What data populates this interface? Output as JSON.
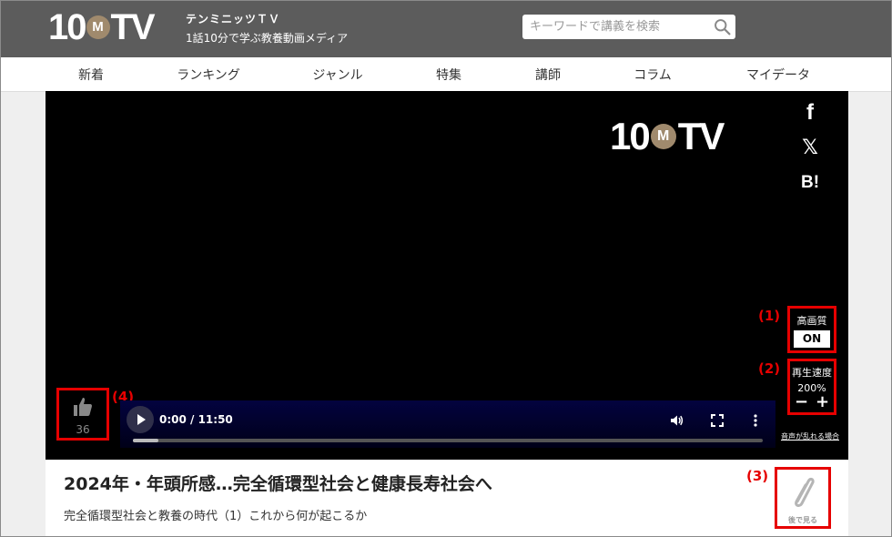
{
  "header": {
    "logo_prefix": "10",
    "logo_ball": "M",
    "logo_suffix": "TV",
    "site_name": "テンミニッツＴＶ",
    "tagline": "1話10分で学ぶ教養動画メディア",
    "search_placeholder": "キーワードで講義を検索",
    "search_icon": "magnifier-icon"
  },
  "nav": {
    "items": [
      {
        "label": "新着"
      },
      {
        "label": "ランキング"
      },
      {
        "label": "ジャンル"
      },
      {
        "label": "特集"
      },
      {
        "label": "講師"
      },
      {
        "label": "コラム"
      },
      {
        "label": "マイデータ"
      }
    ]
  },
  "player": {
    "logo_prefix": "10",
    "logo_ball": "M",
    "logo_suffix": "TV",
    "share": {
      "facebook": "f",
      "x": "𝕏",
      "hatena": "B!"
    },
    "quality": {
      "callout": "(1)",
      "label": "高画質",
      "button": "ON"
    },
    "speed": {
      "callout": "(2)",
      "label": "再生速度",
      "value": "200%",
      "minus": "−",
      "plus": "+"
    },
    "audio_link": "音声が乱れる場合",
    "likes": {
      "callout": "(4)",
      "count": "36",
      "icon": "thumbs-up-icon"
    },
    "controls": {
      "time": "0:00 / 11:50",
      "progress": 0.04,
      "icons": [
        "play-icon",
        "volume-icon",
        "fullscreen-icon",
        "more-icon"
      ]
    }
  },
  "video": {
    "title": "2024年・年頭所感…完全循環型社会と健康長寿社会へ",
    "subtitle": "完全循環型社会と教養の時代（1）これから何が起こるか",
    "later": {
      "callout": "(3)",
      "label": "後で見る",
      "icon": "paperclip-icon"
    }
  },
  "colors": {
    "header_bg": "#5c5c5c",
    "accent_brown": "#a08a6d",
    "annotation_red": "#e60000"
  }
}
